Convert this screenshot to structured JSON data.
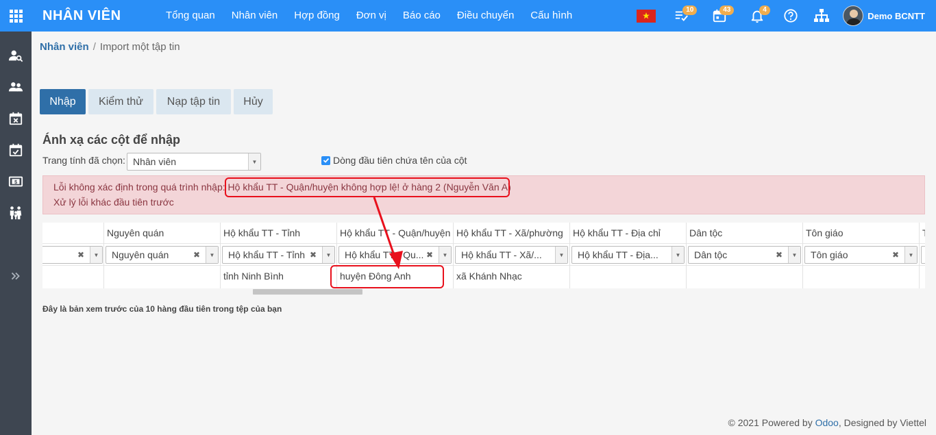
{
  "app": {
    "brand": "NHÂN VIÊN"
  },
  "menu": [
    "Tổng quan",
    "Nhân viên",
    "Hợp đồng",
    "Đơn vị",
    "Báo cáo",
    "Điều chuyển",
    "Cấu hình"
  ],
  "systray": {
    "activity_count": "10",
    "calendar_count": "43",
    "notification_count": "4",
    "user_name": "Demo BCNTT"
  },
  "breadcrumb": {
    "parent": "Nhân viên",
    "separator": "/",
    "current": "Import một tập tin"
  },
  "buttons": {
    "import": "Nhập",
    "test": "Kiểm thử",
    "load_file": "Nạp tập tin",
    "cancel": "Hủy"
  },
  "mapping": {
    "title": "Ánh xạ các cột để nhập",
    "sheet_label": "Trang tính đã chọn:",
    "sheet_value": "Nhân viên",
    "first_row_header_label": "Dòng đầu tiên chứa tên của cột"
  },
  "alert": {
    "prefix": "Lỗi không xác định trong quá trình nhập:",
    "message": "Hộ khẩu TT - Quận/huyện không hợp lệ! ở hàng 2 (Nguyễn Văn A)",
    "line2": "Xử lý lỗi khác đầu tiên trước"
  },
  "grid": {
    "columns": [
      {
        "header": "",
        "mapped": "",
        "value": ""
      },
      {
        "header": "Nguyên quán",
        "mapped": "Nguyên quán",
        "value": ""
      },
      {
        "header": "Hộ khẩu TT - Tỉnh",
        "mapped": "Hộ khẩu TT - Tỉnh",
        "value": "tỉnh Ninh Bình"
      },
      {
        "header": "Hộ khẩu TT - Quận/huyện",
        "mapped": "Hộ khẩu TT - Qu...",
        "value": "huyện Đông Anh"
      },
      {
        "header": "Hộ khẩu TT - Xã/phường",
        "mapped": "Hộ khẩu TT - Xã/...",
        "value": "xã Khánh Nhạc"
      },
      {
        "header": "Hộ khẩu TT - Địa chỉ",
        "mapped": "Hộ khẩu TT - Địa...",
        "value": ""
      },
      {
        "header": "Dân tộc",
        "mapped": "Dân tộc",
        "value": ""
      },
      {
        "header": "Tôn giáo",
        "mapped": "Tôn giáo",
        "value": ""
      },
      {
        "header": "T",
        "mapped": "",
        "value": ""
      }
    ]
  },
  "preview_note": "Đây là bản xem trước của 10 hàng đầu tiên trong tệp của bạn",
  "footer": {
    "prefix": "© 2021 Powered by",
    "odoo": "Odoo",
    "suffix": ", Designed by Viettel"
  },
  "colors": {
    "topbar": "#2a8ff7",
    "sidebar": "#3e4651",
    "primary": "#2f6fa8",
    "alert_bg": "#f3d5d8",
    "annotation_red": "#e8101c"
  }
}
